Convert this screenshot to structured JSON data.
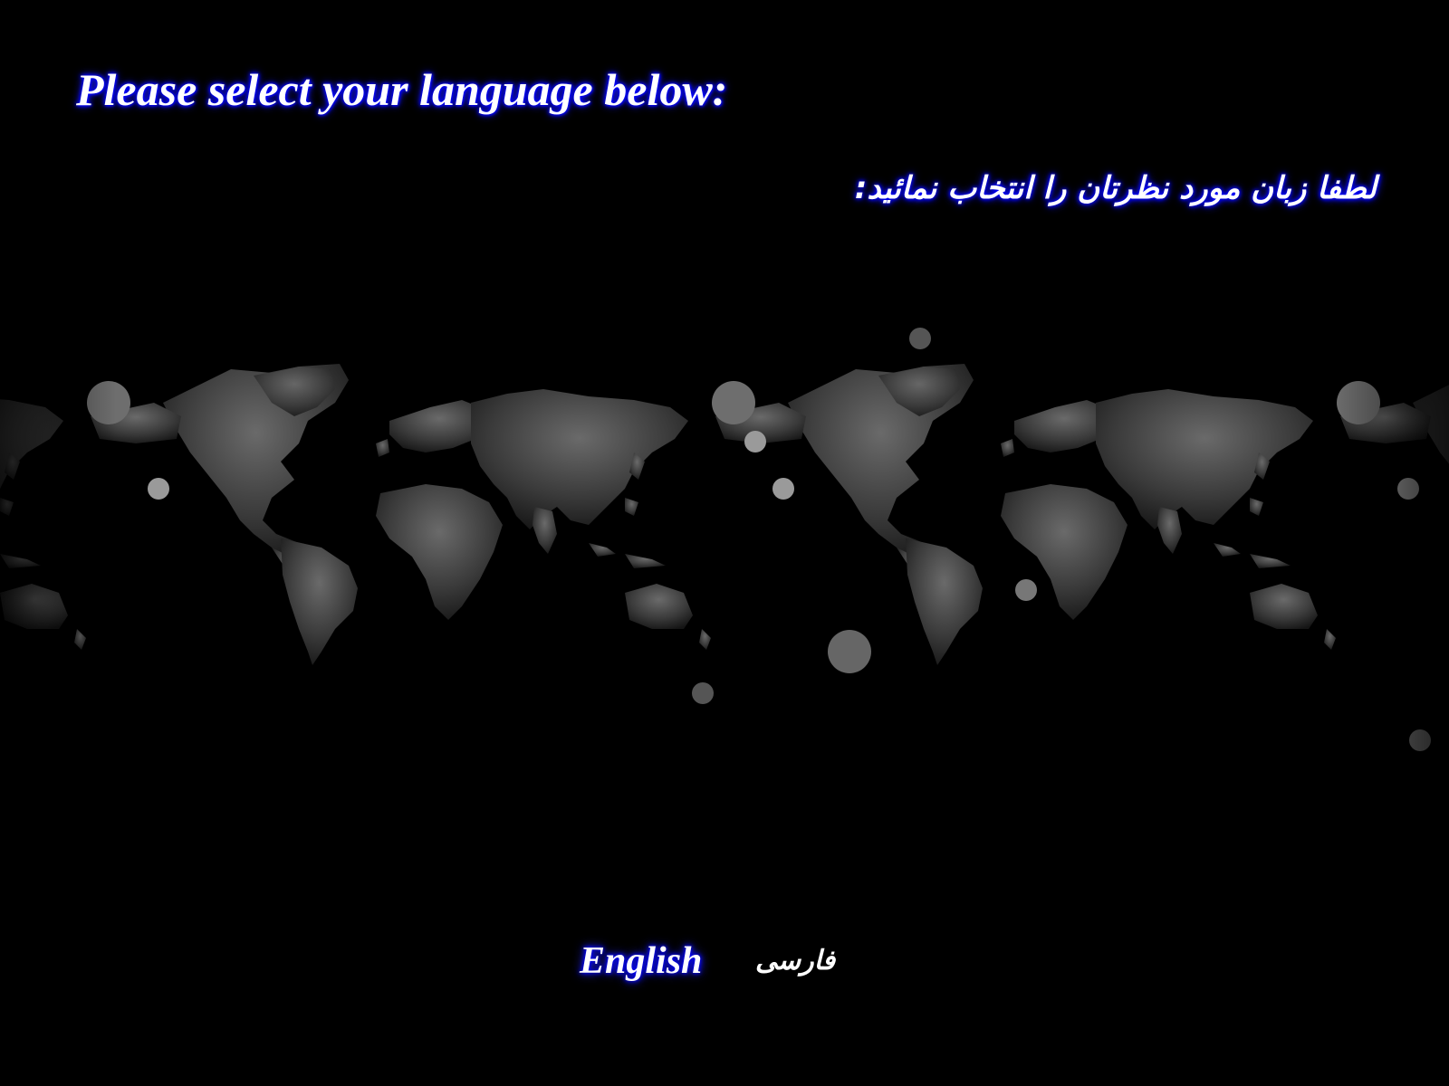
{
  "header": {
    "title_en": "Please select your language below:",
    "title_fa": "لطفا زبان مورد نظرتان را انتخاب نمائید:"
  },
  "background": {
    "image": "world-map-icon",
    "glow_color": "#0000ff",
    "page_color": "#000000"
  },
  "languages": {
    "english_label": "English",
    "farsi_label": "فارسی"
  }
}
